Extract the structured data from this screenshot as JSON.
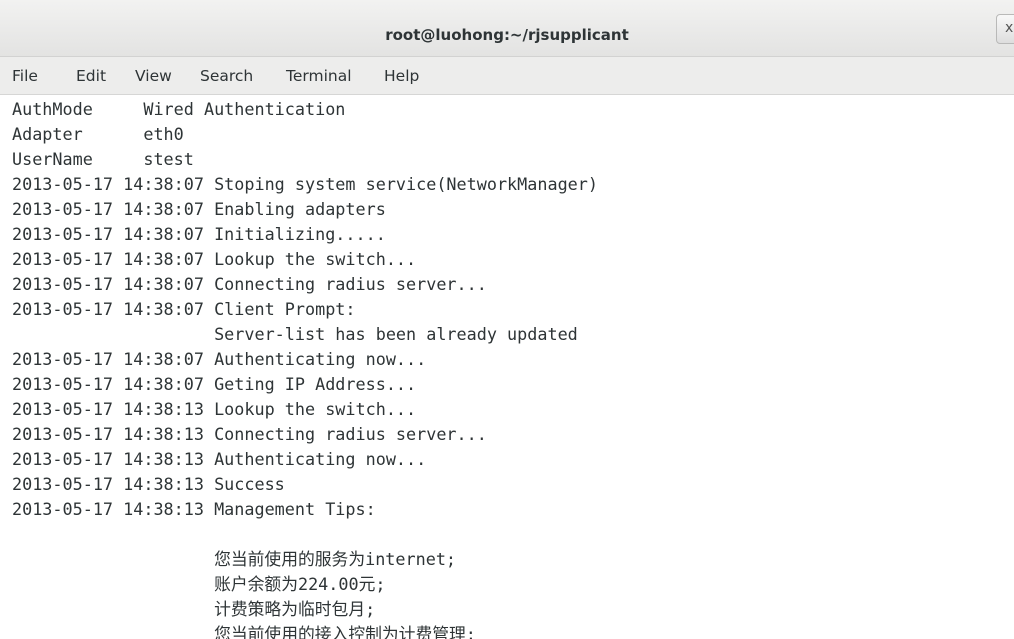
{
  "window": {
    "title": "root@luohong:~/rjsupplicant",
    "close_glyph": "x"
  },
  "menu": {
    "file": "File",
    "edit": "Edit",
    "view": "View",
    "search": "Search",
    "terminal": "Terminal",
    "help": "Help"
  },
  "terminal": {
    "lines": [
      "AuthMode     Wired Authentication",
      "Adapter      eth0",
      "UserName     stest",
      "2013-05-17 14:38:07 Stoping system service(NetworkManager)",
      "2013-05-17 14:38:07 Enabling adapters",
      "2013-05-17 14:38:07 Initializing.....",
      "2013-05-17 14:38:07 Lookup the switch...",
      "2013-05-17 14:38:07 Connecting radius server...",
      "2013-05-17 14:38:07 Client Prompt:",
      "                    Server-list has been already updated",
      "2013-05-17 14:38:07 Authenticating now...",
      "2013-05-17 14:38:07 Geting IP Address...",
      "2013-05-17 14:38:13 Lookup the switch...",
      "2013-05-17 14:38:13 Connecting radius server...",
      "2013-05-17 14:38:13 Authenticating now...",
      "2013-05-17 14:38:13 Success",
      "2013-05-17 14:38:13 Management Tips:",
      "",
      "                    您当前使用的服务为internet;",
      "                    账户余额为224.00元;",
      "                    计费策略为临时包月;",
      "                    您当前使用的接入控制为计费管理;"
    ]
  }
}
